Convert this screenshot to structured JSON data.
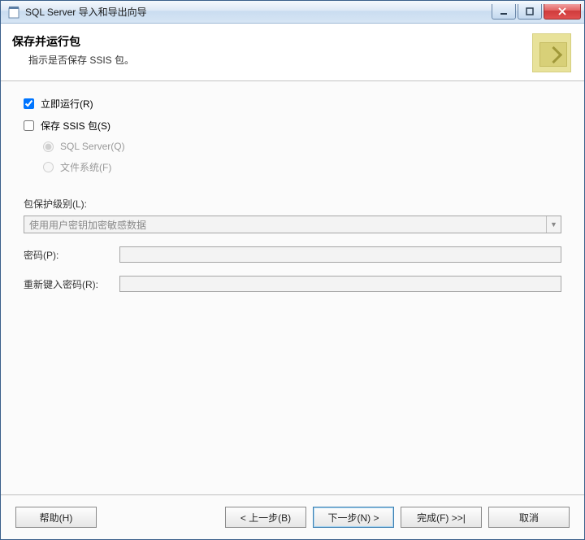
{
  "window": {
    "title": "SQL Server 导入和导出向导"
  },
  "header": {
    "title": "保存并运行包",
    "subtitle": "指示是否保存 SSIS 包。"
  },
  "options": {
    "run_immediately": {
      "label": "立即运行(R)",
      "checked": true
    },
    "save_ssis": {
      "label": "保存 SSIS 包(S)",
      "checked": false
    },
    "radio_sql": {
      "label": "SQL Server(Q)"
    },
    "radio_fs": {
      "label": "文件系统(F)"
    }
  },
  "protection": {
    "label": "包保护级别(L):",
    "selected": "使用用户密钥加密敏感数据",
    "password_label": "密码(P):",
    "retype_label": "重新键入密码(R):",
    "password_value": "",
    "retype_value": ""
  },
  "footer": {
    "help": "帮助(H)",
    "back": "< 上一步(B)",
    "next": "下一步(N) >",
    "finish": "完成(F) >>|",
    "cancel": "取消"
  }
}
